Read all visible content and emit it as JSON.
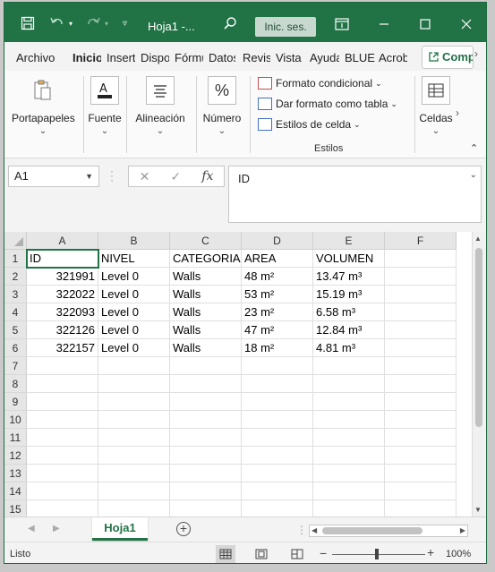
{
  "titlebar": {
    "doc_title": "Hoja1  -...",
    "sign_in": "Inic. ses.",
    "accent": "#217346"
  },
  "tabs": [
    {
      "label": "Archivo",
      "active": false
    },
    {
      "label": "Inicio",
      "active": true
    },
    {
      "label": "Insertar",
      "active": false
    },
    {
      "label": "Disposición",
      "active": false
    },
    {
      "label": "Fórmulas",
      "active": false
    },
    {
      "label": "Datos",
      "active": false
    },
    {
      "label": "Revisar",
      "active": false
    },
    {
      "label": "Vista",
      "active": false
    },
    {
      "label": "Ayuda",
      "active": false
    },
    {
      "label": "BLUE",
      "active": false
    },
    {
      "label": "Acrobat",
      "active": false
    }
  ],
  "share_label": "Compartir",
  "ribbon": {
    "portapapeles": "Portapapeles",
    "fuente": "Fuente",
    "alineacion": "Alineación",
    "numero": "Número",
    "formato_condicional": "Formato condicional",
    "dar_formato_tabla": "Dar formato como tabla",
    "estilos_celda": "Estilos de celda",
    "estilos_group": "Estilos",
    "celdas": "Celdas"
  },
  "formula_bar": {
    "name_box": "A1",
    "fx": "fx",
    "content": "ID"
  },
  "sheet": {
    "columns": [
      "A",
      "B",
      "C",
      "D",
      "E",
      "F"
    ],
    "row_numbers": [
      "1",
      "2",
      "3",
      "4",
      "5",
      "6",
      "7",
      "8",
      "9",
      "10",
      "11",
      "12",
      "13",
      "14",
      "15"
    ],
    "rows": [
      [
        "ID",
        "NIVEL",
        "CATEGORIA",
        "AREA",
        "VOLUMEN",
        ""
      ],
      [
        "321991",
        "Level 0",
        "Walls",
        "48 m²",
        "13.47 m³",
        ""
      ],
      [
        "322022",
        "Level 0",
        "Walls",
        "53 m²",
        "15.19 m³",
        ""
      ],
      [
        "322093",
        "Level 0",
        "Walls",
        "23 m²",
        "6.58 m³",
        ""
      ],
      [
        "322126",
        "Level 0",
        "Walls",
        "47 m²",
        "12.84 m³",
        ""
      ],
      [
        "322157",
        "Level 0",
        "Walls",
        "18 m²",
        "4.81 m³",
        ""
      ]
    ],
    "selected_cell": "A1"
  },
  "sheet_tabs": {
    "active": "Hoja1"
  },
  "status": {
    "text": "Listo",
    "zoom": "100%"
  }
}
